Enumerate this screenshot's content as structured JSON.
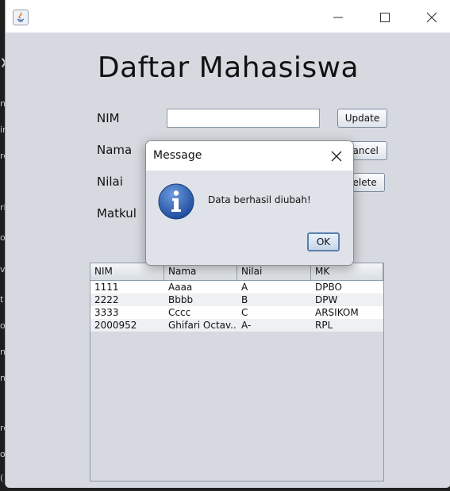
{
  "window": {
    "title": ""
  },
  "form": {
    "heading": "Daftar Mahasiswa",
    "labels": {
      "nim": "NIM",
      "nama": "Nama",
      "nilai": "Nilai",
      "matkul": "Matkul"
    },
    "nim_value": "",
    "buttons": {
      "update": "Update",
      "cancel": "Cancel",
      "delete": "Delete"
    }
  },
  "table": {
    "columns": [
      "NIM",
      "Nama",
      "Nilai",
      "MK"
    ],
    "rows": [
      [
        "1111",
        "Aaaa",
        "A",
        "DPBO"
      ],
      [
        "2222",
        "Bbbb",
        "B",
        "DPW"
      ],
      [
        "3333",
        "Cccc",
        "C",
        "ARSIKOM"
      ],
      [
        "2000952",
        "Ghifari Octav...",
        "A-",
        "RPL"
      ]
    ]
  },
  "dialog": {
    "title": "Message",
    "message": "Data berhasil diubah!",
    "ok_label": "OK",
    "icon": "info-icon"
  },
  "colors": {
    "window_bg": "#d6d9df",
    "accent_blue": "#2f5fb4"
  }
}
